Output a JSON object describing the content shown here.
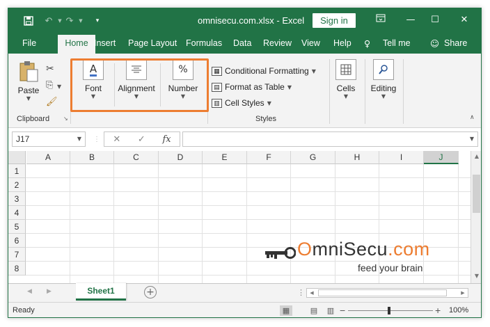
{
  "window": {
    "title": "omnisecu.com.xlsx  -  Excel",
    "sign_in_label": "Sign in",
    "colors": {
      "accent": "#217346",
      "highlight": "#ed7d31"
    }
  },
  "quick_access": {
    "save_icon": "save-icon",
    "undo_icon": "undo-icon",
    "redo_icon": "redo-icon",
    "customize_icon": "customize-qat-icon"
  },
  "menu": {
    "tabs": [
      "File",
      "Home",
      "Insert",
      "Page Layout",
      "Formulas",
      "Data",
      "Review",
      "View",
      "Help"
    ],
    "tell_me": "Tell me",
    "share": "Share"
  },
  "ribbon": {
    "clipboard": {
      "paste_label": "Paste",
      "group_label": "Clipboard"
    },
    "font_label": "Font",
    "alignment_label": "Alignment",
    "number_label": "Number",
    "number_icon_glyph": "%",
    "font_icon_glyph": "A",
    "styles": {
      "conditional_formatting": "Conditional Formatting",
      "format_as_table": "Format as Table",
      "cell_styles": "Cell Styles",
      "group_label": "Styles"
    },
    "cells_label": "Cells",
    "editing_label": "Editing"
  },
  "formula_bar": {
    "name_box": "J17",
    "cancel_glyph": "✕",
    "enter_glyph": "✓",
    "fx_label": "fx",
    "value": ""
  },
  "grid": {
    "columns": [
      "A",
      "B",
      "C",
      "D",
      "E",
      "F",
      "G",
      "H",
      "I",
      "J"
    ],
    "selected_column": "J",
    "rows": [
      "1",
      "2",
      "3",
      "4",
      "5",
      "6",
      "7",
      "8"
    ]
  },
  "logo": {
    "text_orange": "O",
    "text_main": "mniSecu",
    "text_suffix": ".com",
    "tagline": "feed your brain"
  },
  "sheets": {
    "tabs": [
      "Sheet1"
    ],
    "active": "Sheet1",
    "add_glyph": "+"
  },
  "status": {
    "text": "Ready",
    "zoom": "100%",
    "zoom_minus": "−",
    "zoom_plus": "+"
  }
}
